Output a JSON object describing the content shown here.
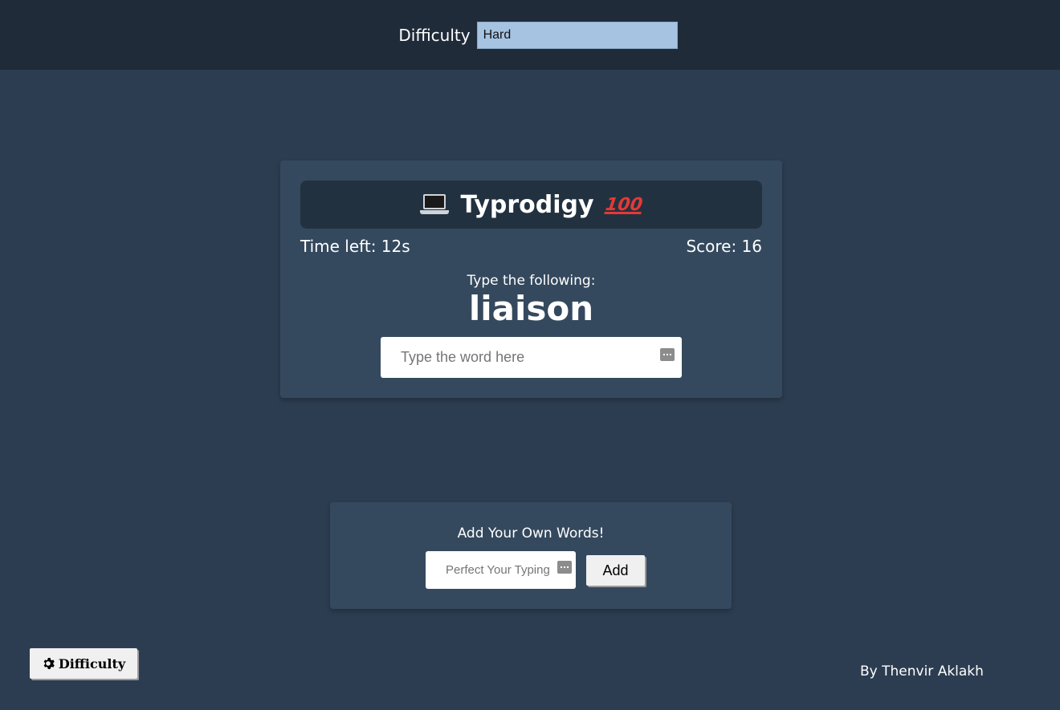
{
  "topbar": {
    "difficulty_label": "Difficulty",
    "difficulty_value": "Hard"
  },
  "game": {
    "title": "Typrodigy",
    "title_icons": [
      "laptop-icon",
      "hundred-points-icon"
    ],
    "hundred_emoji_text": "100",
    "time_left": "Time left: 12s",
    "score": "Score: 16",
    "prompt": "Type the following:",
    "word": "liaison",
    "input_placeholder": "Type the word here"
  },
  "add_words": {
    "title": "Add Your Own Words!",
    "input_placeholder": "Perfect Your Typing",
    "button_label": "Add"
  },
  "settings_button": {
    "label": "Difficulty",
    "icon": "gear-icon"
  },
  "footer": {
    "credit": "By Thenvir Aklakh"
  },
  "colors": {
    "background": "#2c3d51",
    "topbar": "#202b3a",
    "card": "#34495e",
    "title_bar": "#223140",
    "select_bg": "#a6c3e2"
  }
}
